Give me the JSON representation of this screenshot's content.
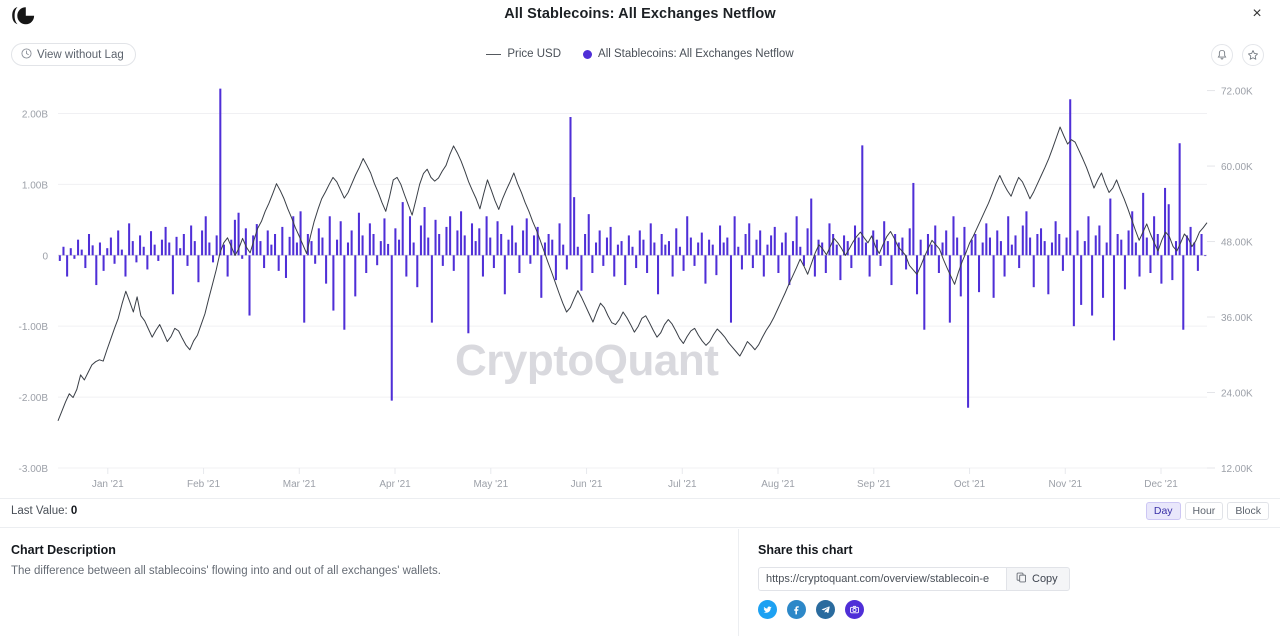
{
  "header": {
    "logo_icon": "cryptoquant-logo-icon",
    "title": "All Stablecoins: All Exchanges Netflow",
    "close_label": "×",
    "lag_button_label": "View without Lag",
    "lag_button_icon": "clock-icon",
    "bell_icon": "bell-icon",
    "star_icon": "star-icon"
  },
  "legend": [
    {
      "label": "Price USD",
      "marker": "line",
      "color": "#55595f"
    },
    {
      "label": "All Stablecoins: All Exchanges Netflow",
      "marker": "dot",
      "color": "#4f2fd7"
    }
  ],
  "watermark": "CryptoQuant",
  "footer": {
    "last_value_label": "Last Value:",
    "last_value": "0",
    "intervals": [
      {
        "label": "Day",
        "active": true
      },
      {
        "label": "Hour",
        "active": false
      },
      {
        "label": "Block",
        "active": false
      }
    ]
  },
  "description": {
    "title": "Chart Description",
    "text": "The difference between all stablecoins' flowing into and out of all exchanges' wallets."
  },
  "share": {
    "title": "Share this chart",
    "url": "https://cryptoquant.com/overview/stablecoin-e",
    "copy_label": "Copy",
    "copy_icon": "copy-icon",
    "socials": [
      {
        "name": "twitter-share-icon",
        "color": "#1da1f2",
        "glyph": "ᵛ"
      },
      {
        "name": "facebook-share-icon",
        "color": "#2d88c8",
        "glyph": "f"
      },
      {
        "name": "telegram-share-icon",
        "color": "#2a6b9e",
        "glyph": "➤"
      },
      {
        "name": "screenshot-share-icon",
        "color": "#4f2fd7",
        "glyph": "◉"
      }
    ]
  },
  "chart_data": {
    "type": "bar",
    "title": "All Stablecoins: All Exchanges Netflow",
    "xlabel": "",
    "ylabel": "",
    "grid": true,
    "legend_position": "top-center",
    "bar_color": "#4f2fd7",
    "line_color": "#3a3f47",
    "x_ticks": [
      "Jan '21",
      "Feb '21",
      "Mar '21",
      "Apr '21",
      "May '21",
      "Jun '21",
      "Jul '21",
      "Aug '21",
      "Sep '21",
      "Oct '21",
      "Nov '21",
      "Dec '21"
    ],
    "y_left_ticks": [
      "2.00B",
      "1.00B",
      "0",
      "-1.00B",
      "-2.00B",
      "-3.00B"
    ],
    "y_left_values": [
      2000000000,
      1000000000,
      0,
      -1000000000,
      -2000000000,
      -3000000000
    ],
    "ylim_left": [
      -3000000000,
      2500000000
    ],
    "y_right_ticks": [
      "72.00K",
      "60.00K",
      "48.00K",
      "36.00K",
      "24.00K",
      "12.00K"
    ],
    "y_right_values": [
      72000,
      60000,
      48000,
      36000,
      24000,
      12000
    ],
    "ylim_right": [
      12000,
      74000
    ],
    "series": [
      {
        "name": "All Stablecoins: All Exchanges Netflow",
        "type": "bar",
        "axis": "left",
        "unit": "B",
        "values": [
          -0.08,
          0.12,
          -0.3,
          0.1,
          -0.05,
          0.22,
          0.08,
          -0.18,
          0.3,
          0.14,
          -0.42,
          0.18,
          -0.22,
          0.1,
          0.25,
          -0.12,
          0.35,
          0.08,
          -0.3,
          0.45,
          0.2,
          -0.1,
          0.28,
          0.12,
          -0.2,
          0.34,
          0.15,
          -0.08,
          0.22,
          0.4,
          0.18,
          -0.55,
          0.26,
          0.1,
          0.3,
          -0.15,
          0.42,
          0.2,
          -0.38,
          0.35,
          0.55,
          0.18,
          -0.1,
          0.28,
          2.35,
          0.15,
          -0.3,
          0.22,
          0.5,
          0.6,
          -0.05,
          0.38,
          -0.85,
          0.28,
          0.44,
          0.2,
          -0.18,
          0.35,
          0.15,
          0.3,
          -0.22,
          0.4,
          -0.32,
          0.26,
          0.55,
          0.18,
          0.62,
          -0.95,
          0.3,
          0.2,
          -0.12,
          0.38,
          0.25,
          -0.4,
          0.55,
          -0.78,
          0.22,
          0.48,
          -1.05,
          0.18,
          0.35,
          -0.58,
          0.6,
          0.28,
          -0.25,
          0.45,
          0.3,
          -0.14,
          0.2,
          0.52,
          0.16,
          -2.05,
          0.38,
          0.22,
          0.75,
          -0.3,
          0.55,
          0.18,
          -0.45,
          0.42,
          0.68,
          0.25,
          -0.95,
          0.5,
          0.3,
          -0.15,
          0.4,
          0.55,
          -0.22,
          0.35,
          0.62,
          0.28,
          -1.1,
          0.45,
          0.2,
          0.38,
          -0.3,
          0.55,
          0.25,
          -0.18,
          0.48,
          0.3,
          -0.55,
          0.22,
          0.42,
          0.18,
          -0.25,
          0.35,
          0.52,
          -0.12,
          0.28,
          0.4,
          -0.6,
          0.18,
          0.3,
          0.22,
          -0.35,
          0.45,
          0.15,
          -0.2,
          1.95,
          0.82,
          0.12,
          -0.5,
          0.3,
          0.58,
          -0.25,
          0.18,
          0.35,
          -0.15,
          0.25,
          0.4,
          -0.3,
          0.15,
          0.2,
          -0.42,
          0.28,
          0.12,
          -0.18,
          0.35,
          0.22,
          -0.25,
          0.45,
          0.18,
          -0.55,
          0.3,
          0.15,
          0.2,
          -0.3,
          0.38,
          0.12,
          -0.22,
          0.55,
          0.25,
          -0.15,
          0.18,
          0.32,
          -0.4,
          0.22,
          0.15,
          -0.28,
          0.42,
          0.18,
          0.25,
          -0.95,
          0.55,
          0.12,
          -0.2,
          0.3,
          0.45,
          -0.18,
          0.22,
          0.35,
          -0.3,
          0.15,
          0.28,
          0.4,
          -0.25,
          0.18,
          0.32,
          -0.42,
          0.2,
          0.55,
          0.12,
          -0.15,
          0.38,
          0.8,
          -0.3,
          0.22,
          0.18,
          -0.25,
          0.45,
          0.3,
          0.15,
          -0.35,
          0.28,
          0.2,
          -0.18,
          0.42,
          0.25,
          1.55,
          0.18,
          -0.3,
          0.35,
          0.22,
          -0.15,
          0.48,
          0.2,
          -0.42,
          0.3,
          0.18,
          0.25,
          -0.2,
          0.38,
          1.02,
          -0.55,
          0.22,
          -1.05,
          0.3,
          0.15,
          0.42,
          -0.25,
          0.18,
          0.35,
          -0.95,
          0.55,
          0.25,
          -0.58,
          0.4,
          -2.15,
          0.22,
          0.3,
          -0.52,
          0.18,
          0.45,
          0.25,
          -0.6,
          0.35,
          0.2,
          -0.3,
          0.55,
          0.15,
          0.28,
          -0.18,
          0.42,
          0.62,
          0.25,
          -0.45,
          0.3,
          0.38,
          0.2,
          -0.55,
          0.18,
          0.48,
          0.3,
          -0.22,
          0.25,
          2.2,
          -1.0,
          0.35,
          -0.7,
          0.2,
          0.55,
          -0.85,
          0.28,
          0.42,
          -0.6,
          0.18,
          0.8,
          -1.2,
          0.3,
          0.22,
          -0.48,
          0.35,
          0.62,
          0.18,
          -0.3,
          0.88,
          0.25,
          -0.25,
          0.55,
          0.3,
          -0.4,
          0.95,
          0.72,
          -0.35,
          0.2,
          1.58,
          -1.05,
          0.28,
          0.4,
          0.18,
          -0.22,
          0.3,
          0.0
        ]
      },
      {
        "name": "Price USD",
        "type": "line",
        "axis": "right",
        "values": [
          19500,
          21000,
          22500,
          23800,
          23200,
          24500,
          26800,
          26000,
          27200,
          28400,
          28900,
          29200,
          29000,
          30800,
          32500,
          34200,
          35800,
          38100,
          40100,
          38500,
          36800,
          39200,
          36200,
          35400,
          34100,
          32800,
          33900,
          34800,
          33500,
          32100,
          32900,
          34200,
          33800,
          32600,
          31500,
          30800,
          32200,
          33100,
          34800,
          36500,
          38900,
          41200,
          43500,
          46200,
          47800,
          48600,
          47200,
          45800,
          46900,
          48500,
          47100,
          46200,
          48200,
          50100,
          51200,
          52800,
          54100,
          55600,
          57200,
          56100,
          54800,
          53200,
          51800,
          50200,
          48900,
          47500,
          46100,
          48800,
          51200,
          53100,
          54800,
          55900,
          57100,
          58200,
          57500,
          56200,
          54900,
          55800,
          57200,
          58600,
          59800,
          61200,
          60100,
          58900,
          57200,
          55800,
          54200,
          52800,
          55100,
          57800,
          58200,
          57100,
          55400,
          53800,
          52200,
          54600,
          57100,
          58800,
          59500,
          58200,
          57600,
          58100,
          59200,
          60100,
          61800,
          63200,
          62100,
          60800,
          59200,
          57500,
          56100,
          54800,
          53200,
          55600,
          57800,
          56200,
          54500,
          53100,
          54800,
          56200,
          57500,
          58900,
          57200,
          55800,
          54200,
          52800,
          51200,
          49800,
          48200,
          46500,
          44800,
          43200,
          41500,
          39800,
          38200,
          36800,
          37500,
          38900,
          40200,
          39100,
          37800,
          36500,
          35200,
          36800,
          38200,
          37500,
          36200,
          35100,
          34800,
          35600,
          36800,
          35900,
          34800,
          33600,
          34500,
          35800,
          36200,
          35100,
          33900,
          32800,
          33500,
          34800,
          35600,
          34900,
          33800,
          32600,
          31800,
          32900,
          33800,
          34200,
          33100,
          32200,
          31500,
          32100,
          33200,
          34100,
          33500,
          32800,
          31900,
          31200,
          30500,
          29800,
          30900,
          32100,
          31500,
          30800,
          31600,
          32800,
          33900,
          34800,
          35900,
          37200,
          38500,
          39800,
          41200,
          42500,
          43800,
          45200,
          44100,
          42800,
          44500,
          46200,
          47500,
          46800,
          45900,
          47200,
          48500,
          47800,
          46900,
          45800,
          46800,
          47900,
          48800,
          49500,
          48600,
          47800,
          48900,
          47200,
          46100,
          47500,
          48800,
          49600,
          48500,
          47200,
          46500,
          45800,
          44200,
          43500,
          42800,
          44100,
          45600,
          46900,
          48200,
          47500,
          46800,
          45200,
          43800,
          42500,
          41200,
          43100,
          44800,
          46200,
          47800,
          48900,
          50200,
          51500,
          52800,
          54100,
          55600,
          57200,
          58500,
          57200,
          56100,
          55200,
          56800,
          58200,
          57500,
          56200,
          54800,
          55900,
          57200,
          58500,
          59800,
          61200,
          62800,
          64500,
          66200,
          64800,
          63500,
          64200,
          63800,
          62500,
          61200,
          59800,
          58200,
          56500,
          57800,
          58900,
          57200,
          55800,
          56500,
          57800,
          56200,
          54800,
          53200,
          51500,
          49800,
          48200,
          49500,
          50800,
          49200,
          47800,
          46500,
          48200,
          49500,
          48800,
          47200,
          46500,
          47800,
          49200,
          48500,
          47200,
          48100,
          49500,
          50200,
          51000
        ]
      }
    ]
  }
}
